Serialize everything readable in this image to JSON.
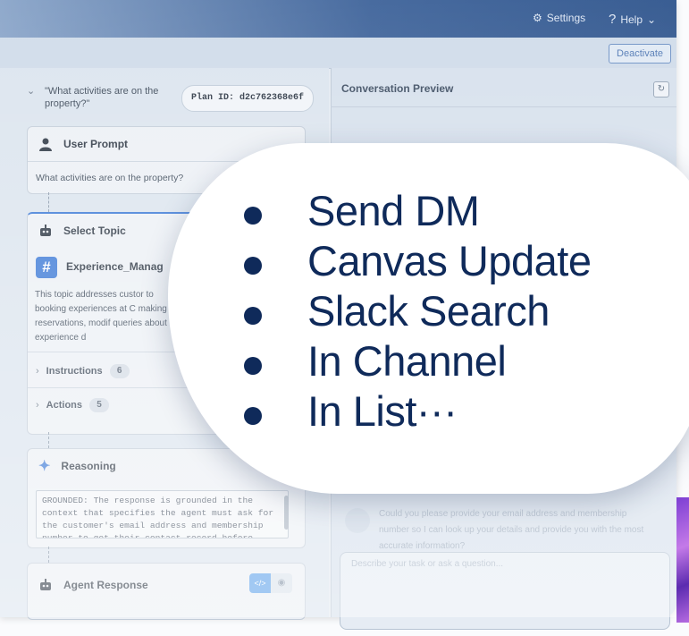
{
  "header": {
    "settings": "Settings",
    "help": "Help",
    "deactivate": "Deactivate"
  },
  "plan": {
    "question": "\"What activities are on the property?\"",
    "plan_id": "Plan ID: d2c762368e6f"
  },
  "user_prompt": {
    "title": "User Prompt",
    "text": "What activities are on the property?"
  },
  "select_topic": {
    "title": "Select Topic",
    "tag": "#",
    "topic_name": "Experience_Manag",
    "description": "This topic addresses custor to booking experiences at C making reservations, modif queries about experience d",
    "instructions_label": "Instructions",
    "instructions_count": "6",
    "actions_label": "Actions",
    "actions_count": "5"
  },
  "reasoning": {
    "title": "Reasoning",
    "text": "GROUNDED: The response is grounded in the context that specifies the agent must ask for the customer's email address and membership number to get their contact record before running any other actions if the customer is not known."
  },
  "agent_response": {
    "title": "Agent Response",
    "code_label": "</>",
    "eye_label": "👁"
  },
  "conversation": {
    "title": "Conversation Preview",
    "bot_message": "Could you please provide your email address and membership number so I can look up your details and provide you with the most accurate information?",
    "placeholder": "Describe your task or ask a question..."
  },
  "bubble": {
    "items": [
      "Send DM",
      "Canvas Update",
      "Slack Search",
      "In Channel",
      "In List···"
    ]
  },
  "colors": {
    "accent": "#3a78d6",
    "bubble_text": "#0f2a5a",
    "topbar": "#2f558d"
  },
  "icons": {
    "settings": "gear-icon",
    "help": "question-icon",
    "user": "user-icon",
    "bot": "robot-icon",
    "sparkle": "sparkle-icon",
    "refresh": "refresh-icon"
  }
}
